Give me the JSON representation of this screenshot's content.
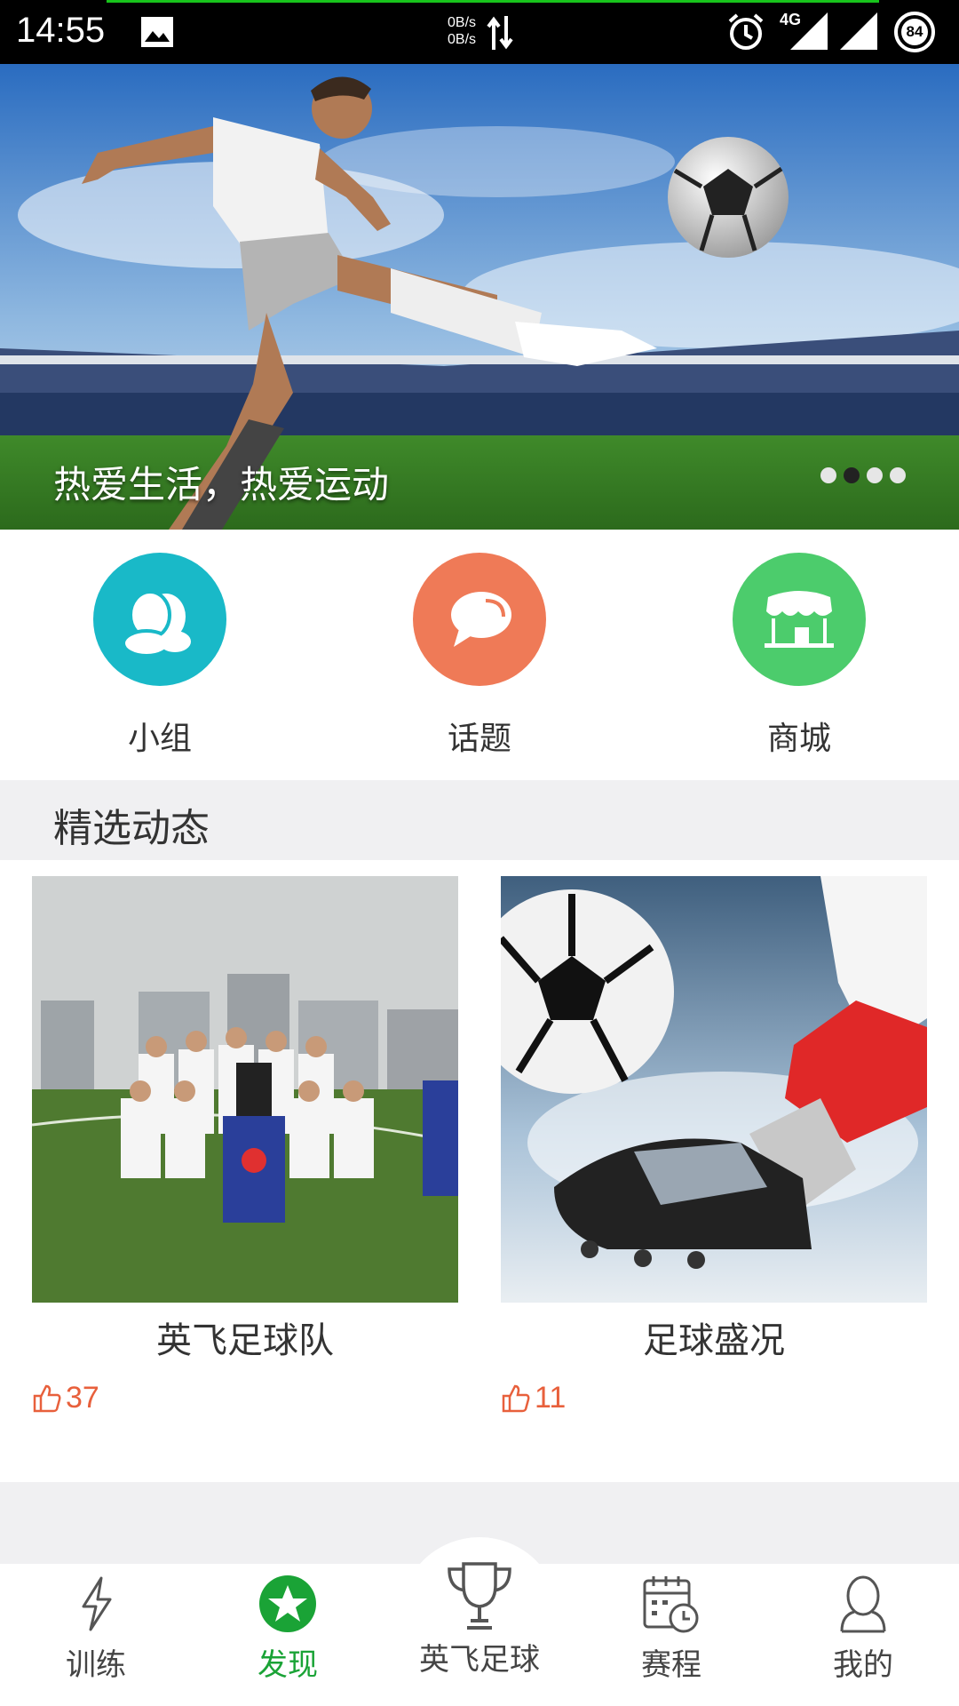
{
  "status_bar": {
    "time": "14:55",
    "net_up": "0B/s",
    "net_down": "0B/s",
    "network_type": "4G",
    "battery": "84",
    "icons": [
      "image-icon",
      "data-transfer-icon",
      "alarm-icon",
      "signal-4g-icon",
      "signal-icon",
      "battery-icon"
    ]
  },
  "banner": {
    "caption": "热爱生活，热爱运动",
    "dots": [
      false,
      true,
      false,
      false
    ]
  },
  "entries": [
    {
      "label": "小组",
      "icon": "group-icon",
      "color": "#19b9c8"
    },
    {
      "label": "话题",
      "icon": "chat-bubble-icon",
      "color": "#ef7a57"
    },
    {
      "label": "商城",
      "icon": "shop-icon",
      "color": "#4ccc6c"
    }
  ],
  "section": {
    "title": "精选动态"
  },
  "cards": [
    {
      "name": "英飞足球队",
      "likes": "37"
    },
    {
      "name": "足球盛况",
      "likes": "11"
    }
  ],
  "bottom_nav": {
    "items": [
      {
        "label": "训练",
        "icon": "lightning-icon",
        "active": false
      },
      {
        "label": "发现",
        "icon": "star-circle-icon",
        "active": true
      },
      {
        "label": "英飞足球",
        "icon": "trophy-icon",
        "active": false
      },
      {
        "label": "赛程",
        "icon": "calendar-clock-icon",
        "active": false
      },
      {
        "label": "我的",
        "icon": "person-icon",
        "active": false
      }
    ],
    "active_color": "#1aa336"
  }
}
